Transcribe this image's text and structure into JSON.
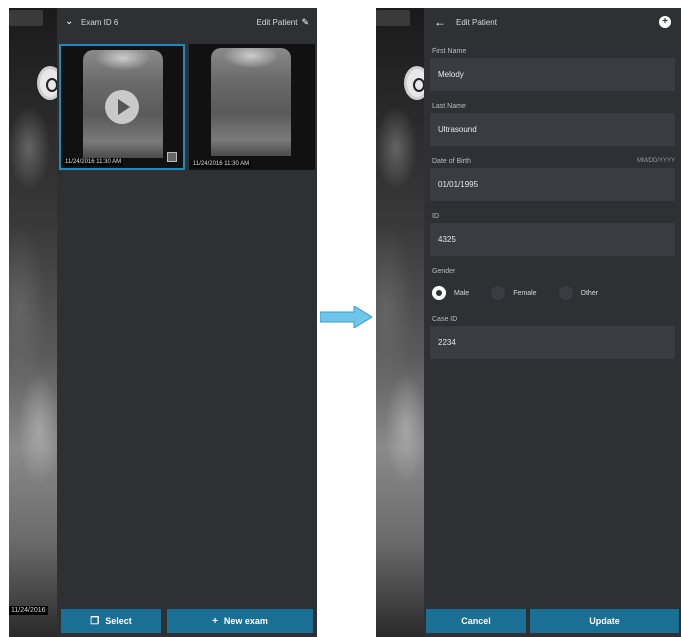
{
  "left_screen": {
    "header": {
      "title": "Exam ID 6",
      "edit_label": "Edit Patient"
    },
    "thumbnails": [
      {
        "caption": "11/24/2016 11:30 AM",
        "selected": true,
        "type": "video"
      },
      {
        "caption": "11/24/2016 11:30 AM",
        "selected": false,
        "type": "image"
      }
    ],
    "background_timestamp": "11/24/2016",
    "bottom_bar": {
      "select_label": "Select",
      "new_exam_label": "New exam"
    }
  },
  "right_screen": {
    "header": {
      "title": "Edit Patient"
    },
    "form": {
      "first_name": {
        "label": "First Name",
        "value": "Melody"
      },
      "last_name": {
        "label": "Last Name",
        "value": "Ultrasound"
      },
      "dob": {
        "label": "Date of Birth",
        "hint": "MM/DD/YYYY",
        "value": "01/01/1995"
      },
      "id": {
        "label": "ID",
        "value": "4325"
      },
      "gender": {
        "label": "Gender",
        "options": [
          "Male",
          "Female",
          "Other"
        ],
        "selected": "Male"
      },
      "case_id": {
        "label": "Case ID",
        "value": "2234"
      }
    },
    "bottom_bar": {
      "cancel_label": "Cancel",
      "update_label": "Update"
    }
  },
  "colors": {
    "panel": "#2f3034",
    "field": "#3b3c41",
    "accent": "#1a6f95",
    "arrow": "#6ec6ea"
  },
  "icons": {
    "expand": "chevron-down-icon",
    "edit": "pencil-icon",
    "back": "arrow-left-icon",
    "add": "plus-circle-icon",
    "select": "select-icon",
    "new": "plus-icon",
    "transition": "right-arrow-icon"
  }
}
